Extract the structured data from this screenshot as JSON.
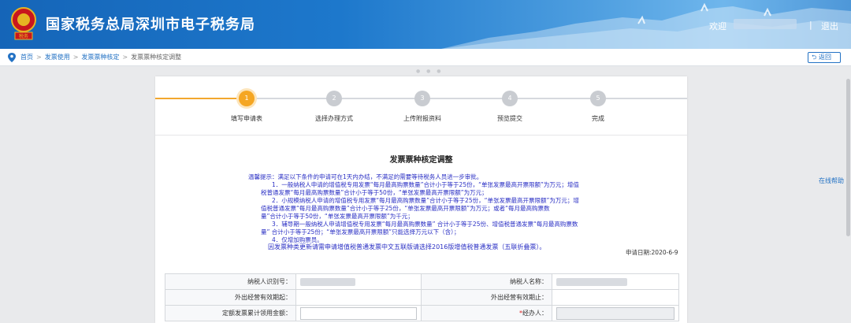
{
  "header": {
    "title": "国家税务总局深圳市电子税务局",
    "welcome": "欢迎",
    "divider": "|",
    "logout": "退出"
  },
  "breadcrumb": {
    "items": [
      "首页",
      "发票使用",
      "发票票种核定",
      "发票票种核定调整"
    ],
    "back_label": "返回"
  },
  "steps": [
    {
      "num": "1",
      "label": "填写申请表",
      "active": true
    },
    {
      "num": "2",
      "label": "选择办理方式",
      "active": false
    },
    {
      "num": "3",
      "label": "上传附报资料",
      "active": false
    },
    {
      "num": "4",
      "label": "预览提交",
      "active": false
    },
    {
      "num": "5",
      "label": "完成",
      "active": false
    }
  ],
  "form": {
    "title": "发票票种核定调整",
    "notice_lines": [
      "温馨提示：满足以下条件的申请可在1天内办结，不满足的需要等待税务人员进一步审批。",
      "1．一般纳税人申请的增值税专用发票“每月最高购票数量”合计小于等于25份，“单张发票最高开票限额”为万元；增值",
      "税普通发票“每月最高购票数量”合计小于等于50份，“单张发票最高开票限额”为万元；",
      "2．小规模纳税人申请的增值税专用发票“每月最高购票数量”合计小于等于25份，“单张发票最高开票限额”为万元；增",
      "值税普通发票“每月最高购票数量”合计小于等于25份，“单张发票最高开票限额”为万元；或者“每月最高购票数",
      "量”合计小于等于50份，“单张发票最高开票限额”为千元；",
      "3．辅导期一般纳税人申请增值税专用发票“每月最高购票数量” 合计小于等于25份、增值税普通发票“每月最高购票数",
      "量” 合计小于等于25份；“单张发票最高开票限额”只能选择万元以下（含）；",
      "4．仅增加购票员。"
    ],
    "note": "因发票种类更新请需申请增值税普通发票中文五联版请选择2016版增值税普通发票（五联折叠票）。",
    "apply_date": "申请日期:2020-6-9"
  },
  "table": {
    "rows": [
      {
        "l1": "纳税人识别号：",
        "l2": "纳税人名称："
      },
      {
        "l1": "外出经营有效期起：",
        "l2": "外出经营有效期止："
      },
      {
        "l1": "定额发票累计领用金额：",
        "l2": "经办人：",
        "l2_required": "*"
      }
    ]
  },
  "help_link": "在线帮助",
  "colors": {
    "header_blue": "#1d78cc",
    "active_step": "#f5a623",
    "notice_text": "#2a2fc4",
    "link": "#2372c4"
  }
}
